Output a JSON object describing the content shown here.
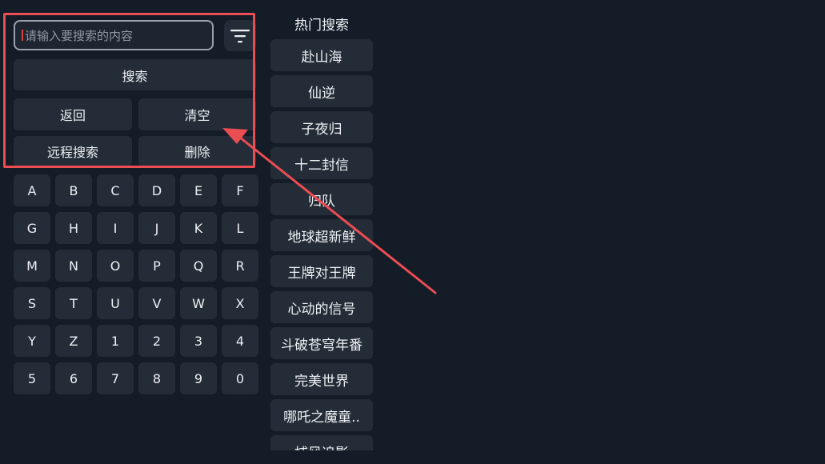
{
  "search": {
    "placeholder": "请输入要搜索的内容",
    "filter_icon": "filter-icon"
  },
  "actions": {
    "search_label": "搜索",
    "back_label": "返回",
    "clear_label": "清空",
    "remote_search_label": "远程搜索",
    "delete_label": "删除"
  },
  "keyboard": {
    "keys": [
      "A",
      "B",
      "C",
      "D",
      "E",
      "F",
      "G",
      "H",
      "I",
      "J",
      "K",
      "L",
      "M",
      "N",
      "O",
      "P",
      "Q",
      "R",
      "S",
      "T",
      "U",
      "V",
      "W",
      "X",
      "Y",
      "Z",
      "1",
      "2",
      "3",
      "4",
      "5",
      "6",
      "7",
      "8",
      "9",
      "0"
    ]
  },
  "hot": {
    "title": "热门搜索",
    "items": [
      "赴山海",
      "仙逆",
      "子夜归",
      "十二封信",
      "归队",
      "地球超新鲜",
      "王牌对王牌",
      "心动的信号",
      "斗破苍穹年番",
      "完美世界",
      "哪吒之魔童..",
      "捕风追影"
    ]
  },
  "colors": {
    "background": "#131c27",
    "button": "#232c37",
    "annotation_red": "#ea4d52"
  }
}
